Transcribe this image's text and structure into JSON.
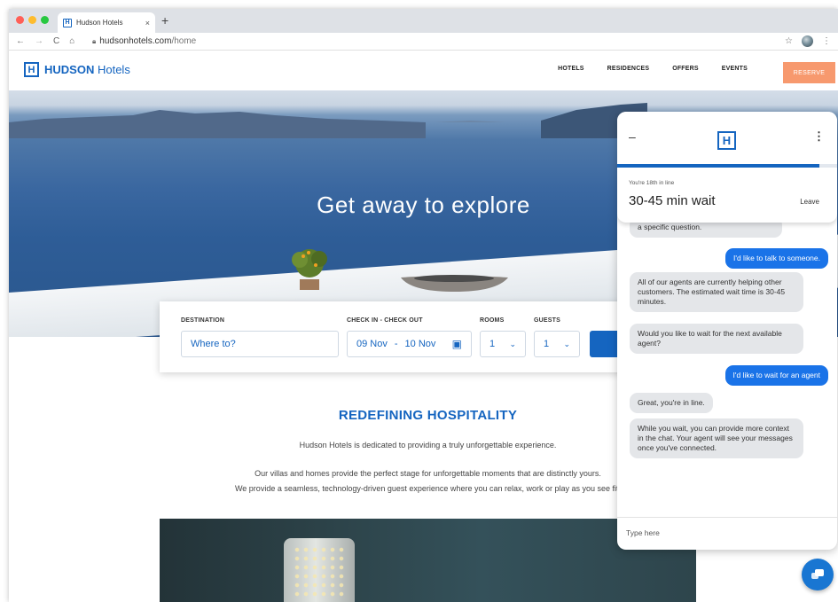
{
  "browser": {
    "tab_title": "Hudson Hotels",
    "tab_close": "×",
    "new_tab": "+",
    "url_host": "hudsonhotels.com",
    "url_path": "/home",
    "traffic_lights": [
      "#ff5f57",
      "#febc2e",
      "#28c840"
    ]
  },
  "header": {
    "logo_letter": "H",
    "brand_bold": "HUDSON",
    "brand_light": "Hotels",
    "nav": [
      "HOTELS",
      "RESIDENCES",
      "OFFERS",
      "EVENTS"
    ],
    "reserve_label": "RESERVE"
  },
  "hero": {
    "title": "Get away to explore"
  },
  "booking": {
    "destination_label": "DESTINATION",
    "destination_placeholder": "Where to?",
    "dates_label": "CHECK IN - CHECK OUT",
    "check_in": "09 Nov",
    "date_separator": "-",
    "check_out": "10 Nov",
    "rooms_label": "ROOMS",
    "rooms_value": "1",
    "guests_label": "GUESTS",
    "guests_value": "1"
  },
  "content": {
    "section_title": "REDEFINING HOSPITALITY",
    "paragraph_1": "Hudson Hotels is dedicated to providing a truly unforgettable experience.",
    "paragraph_2_line_1": "Our villas and homes provide the perfect stage for unforgettable moments that are distinctly yours.",
    "paragraph_2_line_2": "We provide a seamless, technology-driven guest experience where you can relax, work or play as you see fit."
  },
  "chat": {
    "minimize": "–",
    "logo_letter": "H",
    "menu": "⋮",
    "queue_progress": 0.92,
    "queue_position_text": "You're 18th in line",
    "wait_time": "30-45 min wait",
    "leave_label": "Leave",
    "messages": [
      {
        "from": "agent",
        "text": "a specific question."
      },
      {
        "from": "user",
        "text": "I'd like to talk to someone."
      },
      {
        "from": "agent",
        "text": "All of our agents are currently helping other customers. The estimated wait time is 30-45 minutes."
      },
      {
        "from": "agent",
        "text": "Would you like to wait for the next available agent?"
      },
      {
        "from": "user",
        "text": "I'd like to wait for an agent"
      },
      {
        "from": "agent",
        "text": "Great, you're in line."
      },
      {
        "from": "agent",
        "text": "While you wait, you can provide more context in the chat. Your agent will see your messages once you've connected."
      }
    ],
    "input_placeholder": "Type here"
  },
  "colors": {
    "brand_blue": "#1565c0",
    "reserve_orange": "#f7996e",
    "user_bubble": "#1a73e8",
    "agent_bubble": "#e4e6e9"
  }
}
